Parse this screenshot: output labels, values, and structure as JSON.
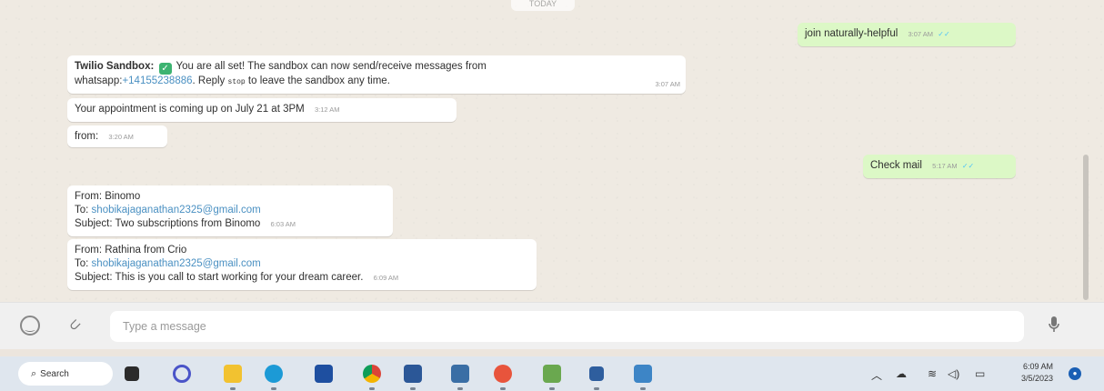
{
  "chat": {
    "top_pill": "TODAY",
    "messages": {
      "out_join": {
        "text": "join naturally-helpful",
        "time": "3:07 AM",
        "ticks": "✓✓"
      },
      "twilio": {
        "sender": "Twilio Sandbox:",
        "emoji": "✓",
        "text_a": "You are all set! The sandbox can now send/receive messages from",
        "text_b_prefix": "whatsapp:",
        "phone": "+14155238886",
        "text_b_mid": ". Reply ",
        "stop": "stop",
        "text_b_suffix": " to leave the sandbox any time.",
        "time": "3:07 AM"
      },
      "appointment": {
        "text": "Your appointment is coming up on July 21 at 3PM",
        "time": "3:12 AM"
      },
      "from": {
        "text": "from:",
        "time": "3:20 AM"
      },
      "out_check": {
        "text": "Check mail",
        "time": "5:17 AM",
        "ticks": "✓✓"
      },
      "binomo": {
        "from": "From: Binomo",
        "to_label": "To: ",
        "to_email": "shobikajaganathan2325@gmail.com",
        "subject": "Subject: Two subscriptions from Binomo",
        "time": "6:03 AM"
      },
      "crio": {
        "from": "From: Rathina from Crio",
        "to_label": "To: ",
        "to_email": "shobikajaganathan2325@gmail.com",
        "subject": "Subject: This is you call to start working for your dream career.",
        "time": "6:09 AM"
      }
    }
  },
  "composer": {
    "placeholder": "Type a message",
    "emoji_icon": "smiley-icon",
    "attach_icon": "paperclip-icon",
    "mic_icon": "microphone-icon"
  },
  "taskbar": {
    "search_label": "Search",
    "clock_time": "6:09 AM",
    "clock_date": "3/5/2023",
    "notification": "●",
    "colors": {
      "taskbar_bg": "#dfe6ee",
      "accent": "#1a5fb4"
    }
  }
}
